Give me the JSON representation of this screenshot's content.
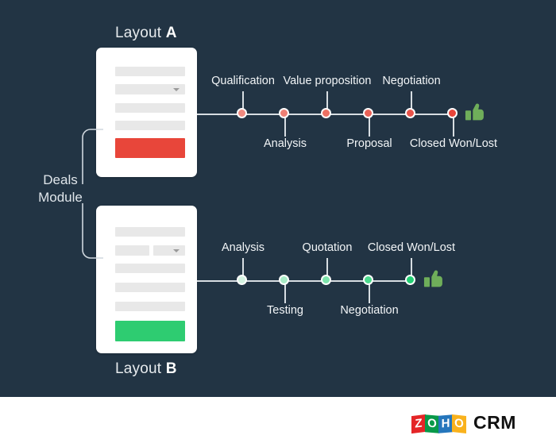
{
  "colors": {
    "background": "#223444",
    "footer_background": "#ffffff",
    "line": "#d7dde2",
    "red_cta": "#e8463a",
    "green_cta": "#2ecc71",
    "thumb_green": "#6fae5a",
    "text": "#f2f5f7"
  },
  "bracket": {
    "label_line1": "Deals",
    "label_line2": "Module"
  },
  "layout_a": {
    "caption_prefix": "Layout",
    "caption_letter": "A",
    "cta_color": "#e8463a",
    "fields": [
      "field-row",
      "dropdown-row",
      "field-row",
      "field-row"
    ],
    "timeline": {
      "nodes": [
        {
          "label": "Qualification",
          "position": "above",
          "color": "#f08a80"
        },
        {
          "label": "Analysis",
          "position": "below",
          "color": "#ee7f74"
        },
        {
          "label": "Value proposition",
          "position": "above",
          "color": "#ec7063"
        },
        {
          "label": "Proposal",
          "position": "below",
          "color": "#ea6257"
        },
        {
          "label": "Negotiation",
          "position": "above",
          "color": "#e8534a"
        },
        {
          "label": "Closed Won/Lost",
          "position": "below",
          "color": "#e8453b"
        }
      ],
      "end_icon": "thumbs-up-icon"
    }
  },
  "layout_b": {
    "caption_prefix": "Layout",
    "caption_letter": "B",
    "cta_color": "#2ecc71",
    "fields": [
      "field-row",
      "split-row-with-dropdown",
      "field-row",
      "field-row",
      "field-row"
    ],
    "timeline": {
      "nodes": [
        {
          "label": "Analysis",
          "position": "above",
          "color": "#d5f3e2"
        },
        {
          "label": "Testing",
          "position": "below",
          "color": "#a8ebc6"
        },
        {
          "label": "Quotation",
          "position": "above",
          "color": "#7de4ac"
        },
        {
          "label": "Negotiation",
          "position": "below",
          "color": "#4cd98d"
        },
        {
          "label": "Closed Won/Lost",
          "position": "above",
          "color": "#23ce74"
        }
      ],
      "end_icon": "thumbs-up-icon"
    }
  },
  "logo": {
    "tiles": [
      "Z",
      "O",
      "H",
      "O"
    ],
    "product": "CRM"
  }
}
